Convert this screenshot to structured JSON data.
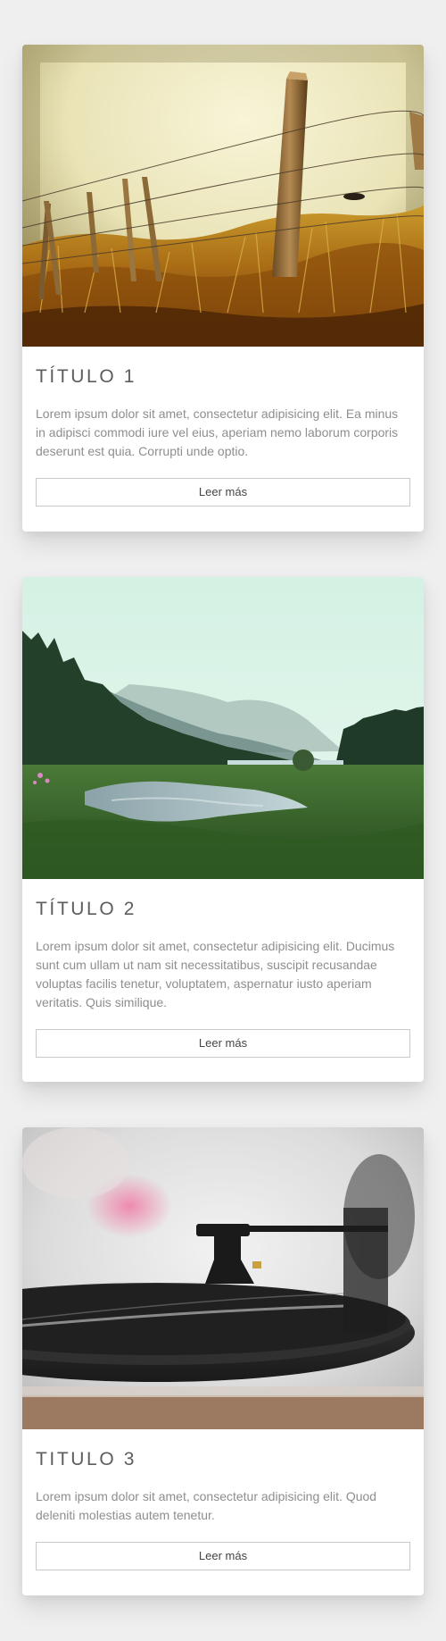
{
  "cards": [
    {
      "title": "TÍTULO 1",
      "text": "Lorem ipsum dolor sit amet, consectetur adipisicing elit. Ea minus in adipisci commodi iure vel eius, aperiam nemo laborum corporis deserunt est quia. Corrupti unde optio.",
      "button_label": "Leer más",
      "image": "fence-grass-photo"
    },
    {
      "title": "TÍTULO 2",
      "text": "Lorem ipsum dolor sit amet, consectetur adipisicing elit. Ducimus sunt cum ullam ut nam sit necessitatibus, suscipit recusandae voluptas facilis tenetur, voluptatem, aspernatur iusto aperiam veritatis. Quis similique.",
      "button_label": "Leer más",
      "image": "river-forest-photo"
    },
    {
      "title": "TITULO 3",
      "text": "Lorem ipsum dolor sit amet, consectetur adipisicing elit. Quod deleniti molestias autem tenetur.",
      "button_label": "Leer más",
      "image": "record-player-photo"
    }
  ],
  "colors": {
    "page_background": "#efefef",
    "card_background": "#ffffff",
    "title": "#5d5d5d",
    "body_text": "#8e8e8e",
    "button_border": "#c9c9c9"
  }
}
